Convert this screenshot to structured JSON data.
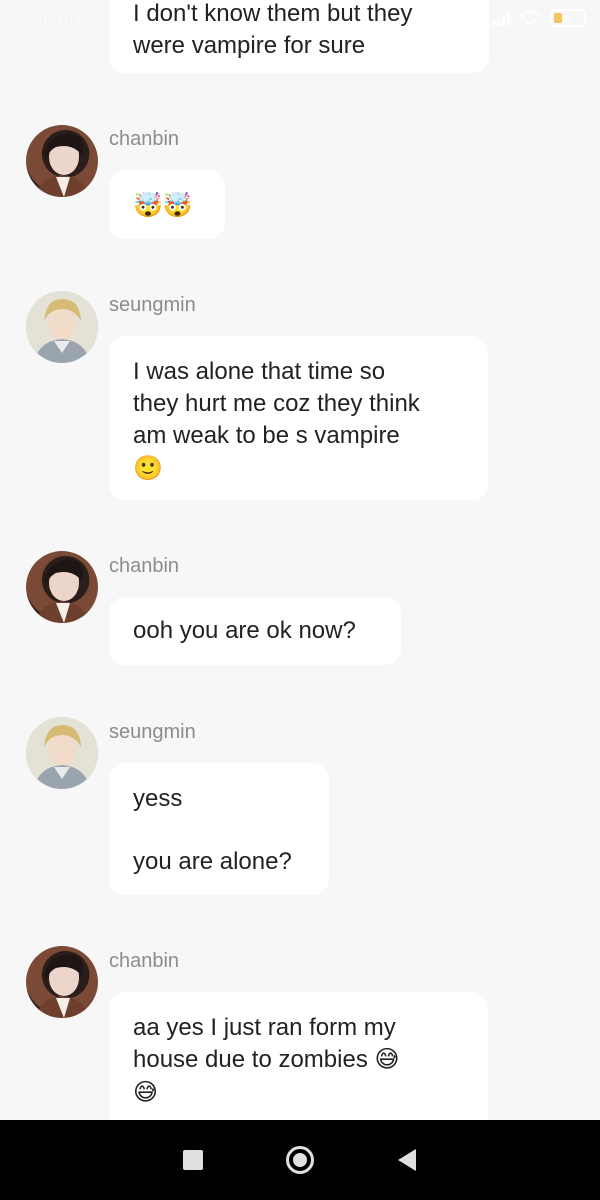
{
  "status_bar": {
    "time": "8:36 AM",
    "battery_level": "4",
    "battery_color": "#f2c14e"
  },
  "messages": [
    {
      "sender": "",
      "lines": [
        "I don't know them but they",
        "were vampire for sure"
      ]
    },
    {
      "sender": "chanbin",
      "lines": [
        "🤯🤯"
      ]
    },
    {
      "sender": "seungmin",
      "lines": [
        "I was alone that time so",
        "they hurt me coz they think",
        "am weak to be s vampire",
        "🙂"
      ]
    },
    {
      "sender": "chanbin",
      "lines": [
        "ooh you are ok now?"
      ]
    },
    {
      "sender": "seungmin",
      "lines": [
        "yess",
        "",
        "you are alone?"
      ]
    },
    {
      "sender": "chanbin",
      "lines": [
        "aa yes I just ran form my",
        "house due to zombies 😅",
        "😅"
      ]
    }
  ],
  "nav_bar": {
    "icons": [
      "recent-apps-icon",
      "home-icon",
      "back-icon"
    ]
  },
  "colors": {
    "background": "#f7f7f7",
    "bubble": "#ffffff",
    "sender_name": "#8c8c8c",
    "text": "#222222"
  }
}
